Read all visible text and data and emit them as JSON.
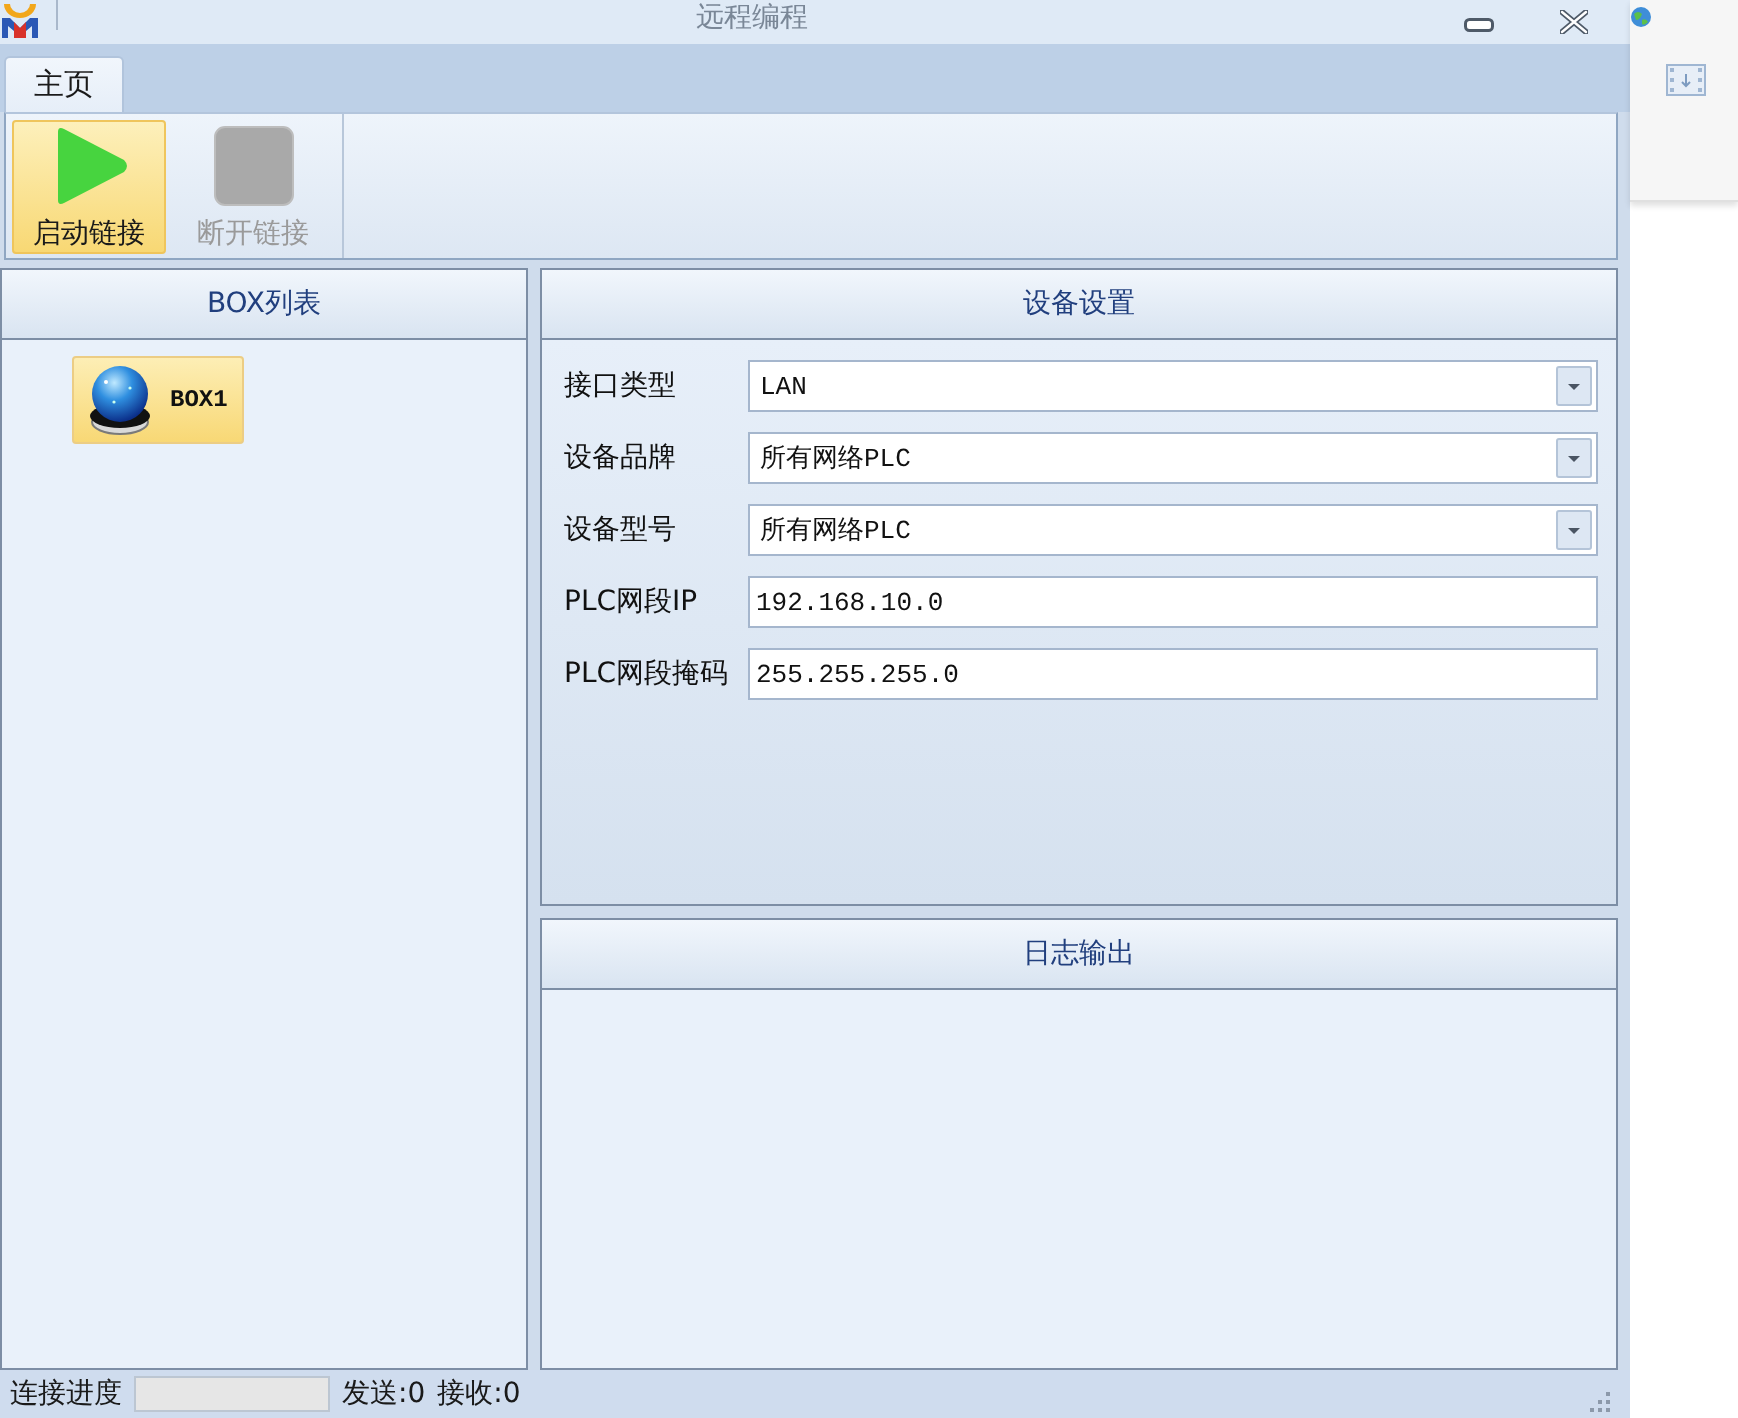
{
  "window": {
    "title": "远程编程"
  },
  "tabs": [
    {
      "label": "主页",
      "selected": true
    }
  ],
  "ribbon": {
    "buttons": [
      {
        "label": "启动链接",
        "kind": "play",
        "highlighted": true,
        "disabled": false
      },
      {
        "label": "断开链接",
        "kind": "stop",
        "highlighted": false,
        "disabled": true
      }
    ]
  },
  "box_list": {
    "title": "BOX列表",
    "items": [
      {
        "label": "BOX1",
        "selected": true
      }
    ]
  },
  "device_settings": {
    "title": "设备设置",
    "fields": [
      {
        "label": "接口类型",
        "kind": "dropdown",
        "value": "LAN"
      },
      {
        "label": "设备品牌",
        "kind": "dropdown",
        "value": "所有网络PLC"
      },
      {
        "label": "设备型号",
        "kind": "dropdown",
        "value": "所有网络PLC"
      },
      {
        "label": "PLC网段IP",
        "kind": "text",
        "value": "192.168.10.0"
      },
      {
        "label": "PLC网段掩码",
        "kind": "text",
        "value": "255.255.255.0"
      }
    ]
  },
  "log_output": {
    "title": "日志输出"
  },
  "status_bar": {
    "progress_label": "连接进度",
    "progress": {
      "level": 0
    },
    "sent": "发送:0",
    "received": "接收:0"
  }
}
